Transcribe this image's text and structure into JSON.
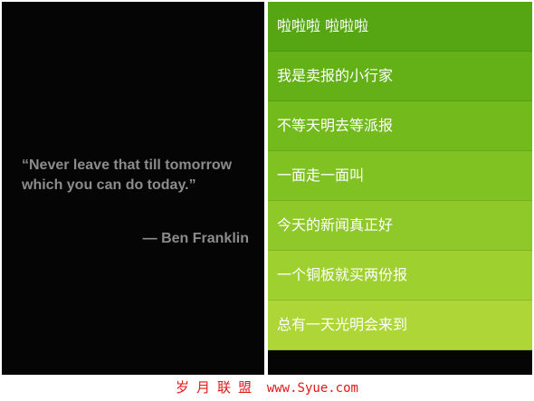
{
  "quote": {
    "text": "“Never leave that till tomorrow which you can do today.”",
    "author": "— Ben Franklin"
  },
  "list": {
    "items": [
      {
        "label": "啦啦啦 啦啦啦"
      },
      {
        "label": "我是卖报的小行家"
      },
      {
        "label": "不等天明去等派报"
      },
      {
        "label": "一面走一面叫"
      },
      {
        "label": "今天的新闻真正好"
      },
      {
        "label": "一个铜板就买两份报"
      },
      {
        "label": "总有一天光明会来到"
      }
    ]
  },
  "watermark": {
    "cn": "岁月联盟",
    "url": "www.Syue.com"
  },
  "colors": {
    "left_background": "#050505",
    "quote_text": "#8c8c8c",
    "row_gradient": [
      "#56a613",
      "#64b117",
      "#73ba1d",
      "#81c223",
      "#8fc929",
      "#9ed030",
      "#aed636"
    ],
    "watermark": "#e01818"
  }
}
